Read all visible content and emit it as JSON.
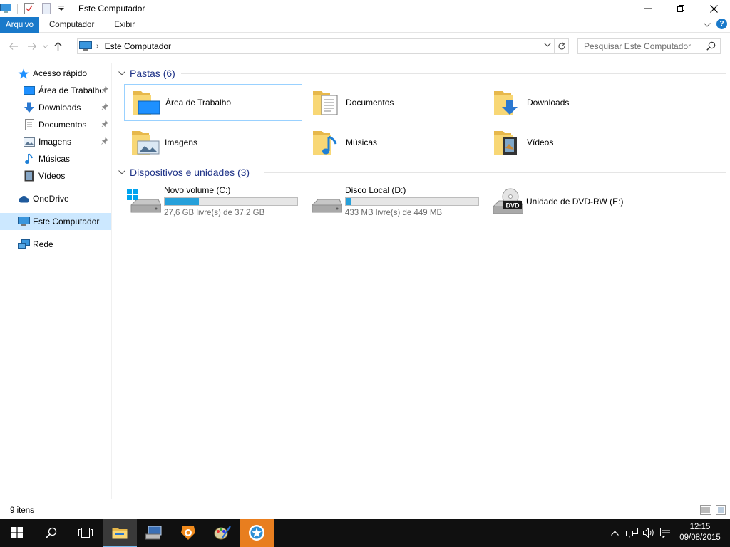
{
  "window": {
    "title": "Este Computador",
    "controls": {
      "minimize": "—",
      "maximize": "❐",
      "close": "✕"
    }
  },
  "ribbon": {
    "tabs": [
      {
        "label": "Arquivo",
        "active": true
      },
      {
        "label": "Computador",
        "active": false
      },
      {
        "label": "Exibir",
        "active": false
      }
    ],
    "help": "?"
  },
  "navigation": {
    "address": "Este Computador",
    "search_placeholder": "Pesquisar Este Computador"
  },
  "sidebar": {
    "items": [
      {
        "label": "Acesso rápido",
        "icon": "star-icon",
        "pinned": false
      },
      {
        "label": "Área de Trabalho",
        "icon": "desktop-icon",
        "pinned": true
      },
      {
        "label": "Downloads",
        "icon": "download-icon",
        "pinned": true
      },
      {
        "label": "Documentos",
        "icon": "document-icon",
        "pinned": true
      },
      {
        "label": "Imagens",
        "icon": "picture-icon",
        "pinned": true
      },
      {
        "label": "Músicas",
        "icon": "music-icon",
        "pinned": false
      },
      {
        "label": "Vídeos",
        "icon": "video-icon",
        "pinned": false
      },
      {
        "label": "OneDrive",
        "icon": "cloud-icon",
        "pinned": false
      },
      {
        "label": "Este Computador",
        "icon": "computer-icon",
        "selected": true
      },
      {
        "label": "Rede",
        "icon": "network-icon",
        "pinned": false
      }
    ]
  },
  "folders": {
    "header": "Pastas (6)",
    "items": [
      {
        "label": "Área de Trabalho",
        "icon": "desktop-folder-icon"
      },
      {
        "label": "Documentos",
        "icon": "documents-folder-icon"
      },
      {
        "label": "Downloads",
        "icon": "downloads-folder-icon"
      },
      {
        "label": "Imagens",
        "icon": "pictures-folder-icon"
      },
      {
        "label": "Músicas",
        "icon": "music-folder-icon"
      },
      {
        "label": "Vídeos",
        "icon": "videos-folder-icon"
      }
    ]
  },
  "devices": {
    "header": "Dispositivos e unidades (3)",
    "items": [
      {
        "label": "Novo volume (C:)",
        "free": "27,6 GB livre(s) de 37,2 GB",
        "used_fraction": 0.26,
        "icon": "windows-drive-icon"
      },
      {
        "label": "Disco Local (D:)",
        "free": "433 MB livre(s) de 449 MB",
        "used_fraction": 0.036,
        "icon": "hard-drive-icon"
      },
      {
        "label": "Unidade de DVD-RW (E:)",
        "icon": "dvd-drive-icon",
        "badge": "DVD"
      }
    ]
  },
  "status": {
    "text": "9 itens"
  },
  "taskbar": {
    "clock_time": "12:15",
    "clock_date": "09/08/2015"
  },
  "colors": {
    "accent": "#1979ca",
    "group_header": "#1e3287",
    "drive_fill": "#26a0da",
    "folder": "#f8d775"
  }
}
